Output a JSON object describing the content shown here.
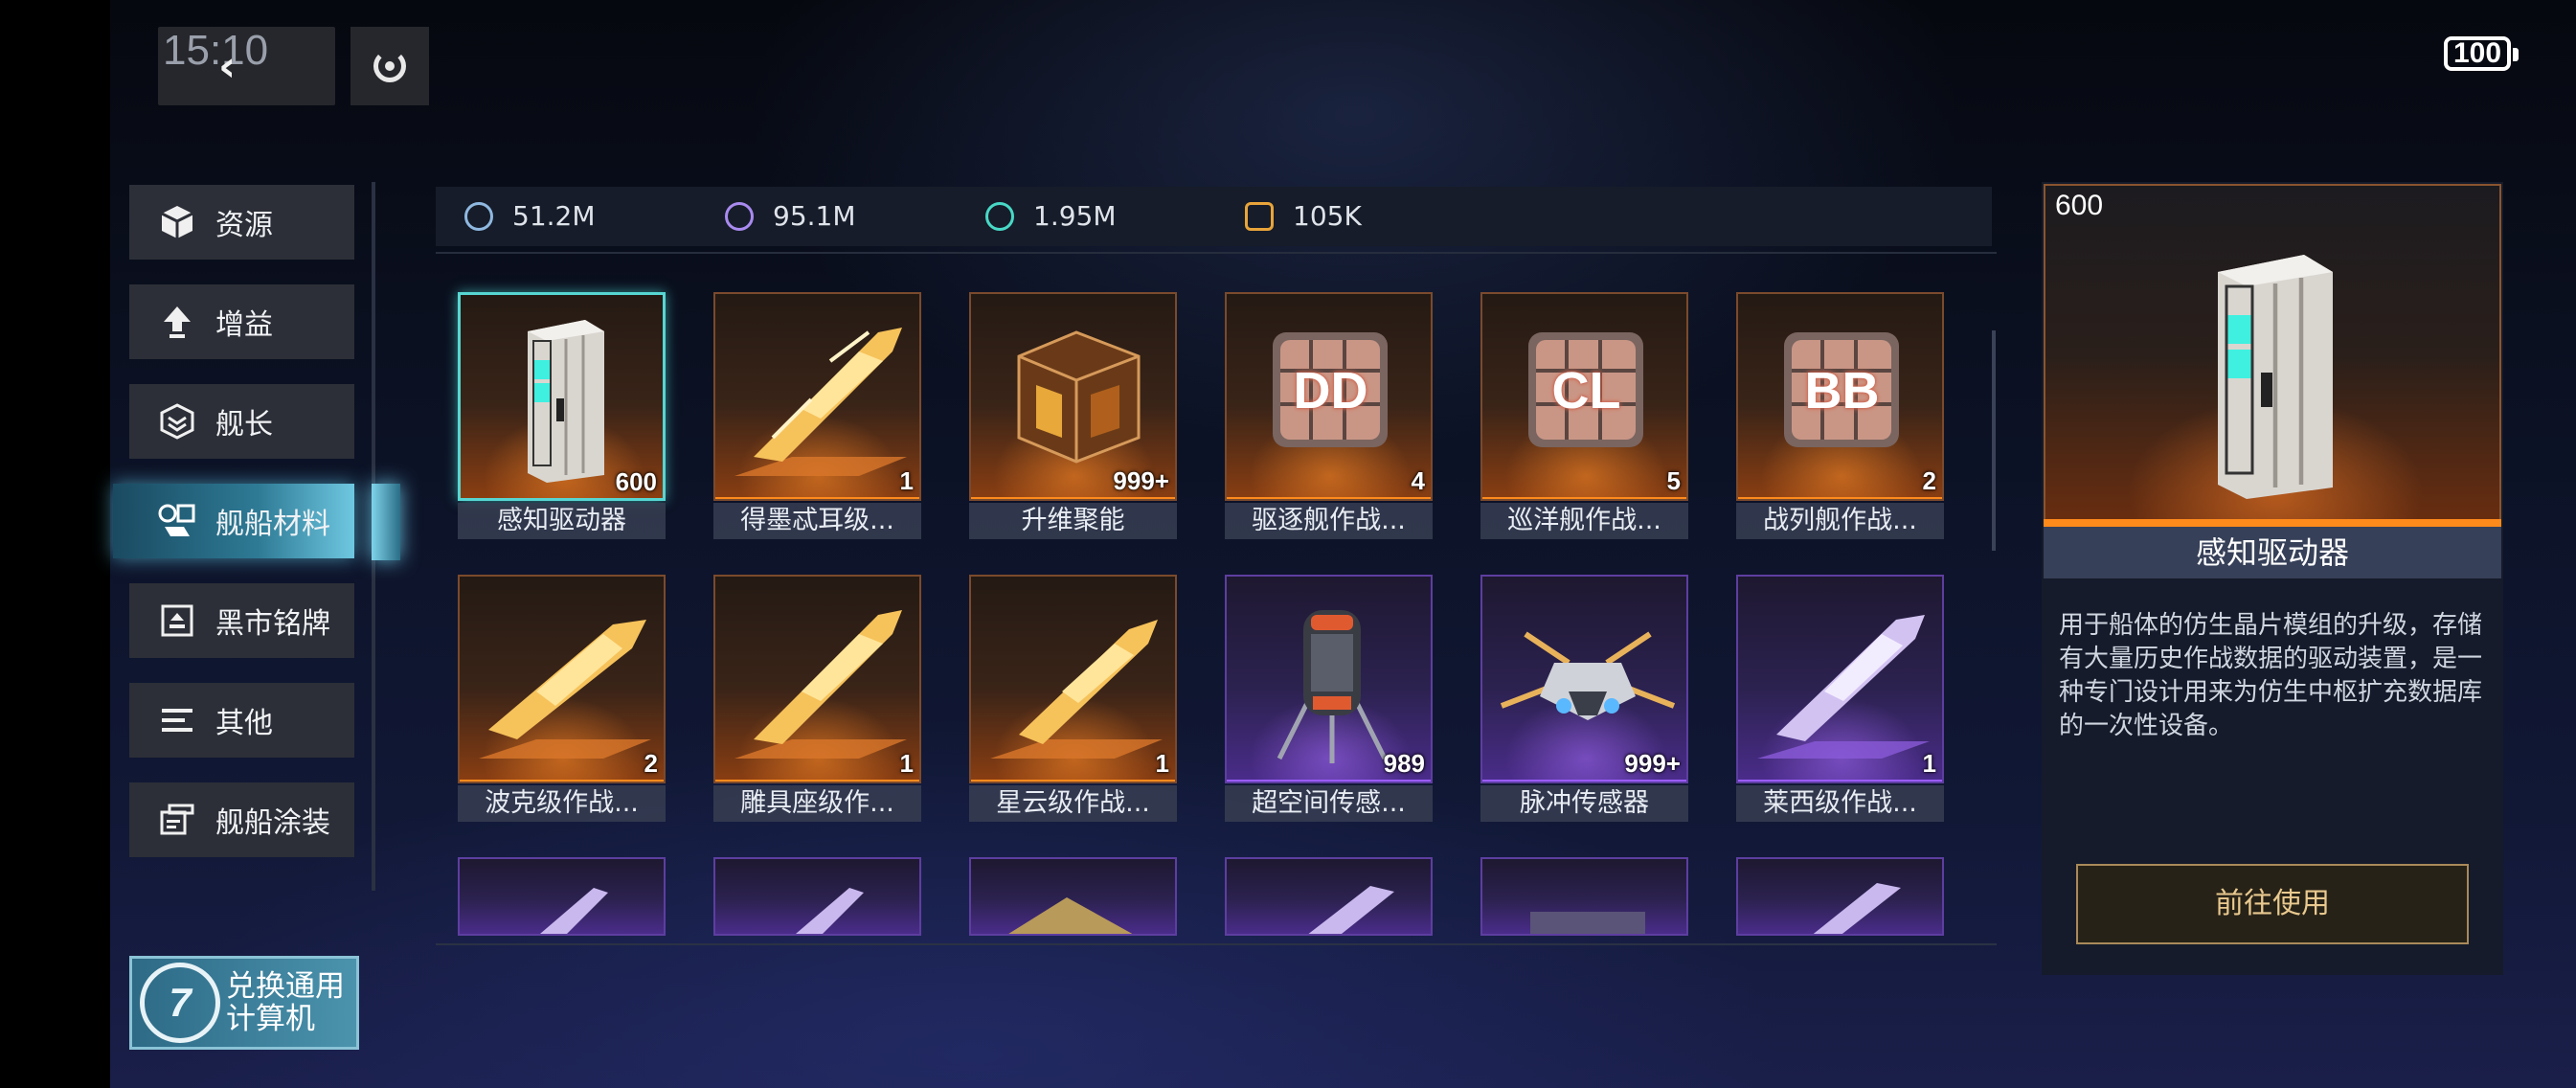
{
  "status": {
    "time": "15:10",
    "battery": "100"
  },
  "sidebar": {
    "items": [
      {
        "label": "资源",
        "icon": "cube-icon"
      },
      {
        "label": "增益",
        "icon": "upgrade-arrow-icon"
      },
      {
        "label": "舰长",
        "icon": "captain-badge-icon"
      },
      {
        "label": "舰船材料",
        "icon": "materials-icon",
        "active": true
      },
      {
        "label": "黑市铭牌",
        "icon": "nameplate-icon"
      },
      {
        "label": "其他",
        "icon": "list-icon"
      },
      {
        "label": "舰船涂装",
        "icon": "paint-icon"
      }
    ],
    "exchange": {
      "logo": "7",
      "label": "兑换通用计算机"
    }
  },
  "resources": [
    {
      "value": "51.2M",
      "icon": "credit-coin-icon",
      "color": "#8fb8e0"
    },
    {
      "value": "95.1M",
      "icon": "purple-crystal-icon",
      "color": "#a98af0"
    },
    {
      "value": "1.95M",
      "icon": "teal-cycle-icon",
      "color": "#48d8c6"
    },
    {
      "value": "105K",
      "icon": "gold-chip-icon",
      "color": "#e8a43a"
    }
  ],
  "items": [
    {
      "label": "感知驱动器",
      "count": "600",
      "rarity": "orange",
      "art": "drive",
      "selected": true
    },
    {
      "label": "得墨忒耳级...",
      "count": "1",
      "rarity": "orange",
      "art": "ship-gold"
    },
    {
      "label": "升维聚能",
      "count": "999+",
      "rarity": "orange",
      "art": "crate"
    },
    {
      "label": "驱逐舰作战...",
      "count": "4",
      "rarity": "orange",
      "art": "cube",
      "tag": "DD"
    },
    {
      "label": "巡洋舰作战...",
      "count": "5",
      "rarity": "orange",
      "art": "cube",
      "tag": "CL"
    },
    {
      "label": "战列舰作战...",
      "count": "2",
      "rarity": "orange",
      "art": "cube",
      "tag": "BB"
    },
    {
      "label": "波克级作战...",
      "count": "2",
      "rarity": "orange",
      "art": "ship-gold"
    },
    {
      "label": "雕具座级作...",
      "count": "1",
      "rarity": "orange",
      "art": "ship-gold"
    },
    {
      "label": "星云级作战...",
      "count": "1",
      "rarity": "orange",
      "art": "ship-gold"
    },
    {
      "label": "超空间传感...",
      "count": "989",
      "rarity": "purple",
      "art": "canister"
    },
    {
      "label": "脉冲传感器",
      "count": "999+",
      "rarity": "purple",
      "art": "drone"
    },
    {
      "label": "莱西级作战...",
      "count": "1",
      "rarity": "purple",
      "art": "ship-violet"
    }
  ],
  "detail": {
    "count": "600",
    "name": "感知驱动器",
    "description": "用于船体的仿生晶片模组的升级，存储有大量历史作战数据的驱动装置，是一种专门设计用来为仿生中枢扩充数据库的一次性设备。",
    "button": "前往使用"
  },
  "colors": {
    "orange": "#ff8a1c",
    "purple": "#9b5cff",
    "accent": "#57d6d2",
    "button_text": "#e9c98f"
  }
}
